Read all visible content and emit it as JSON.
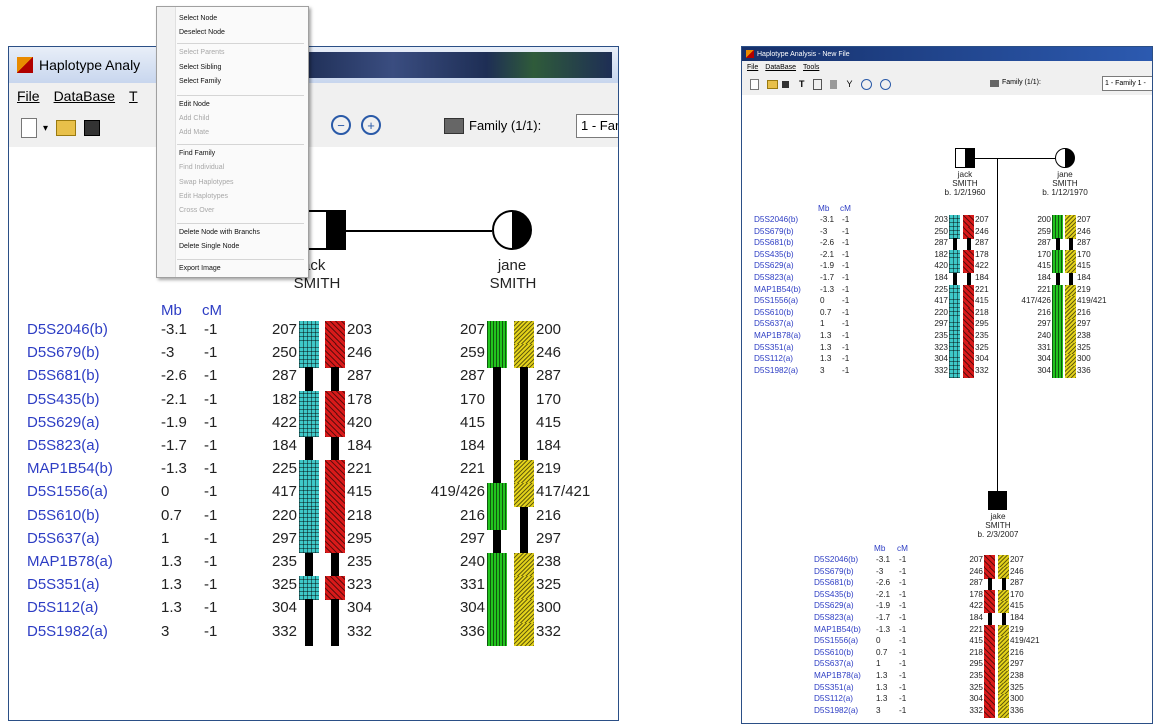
{
  "left_window": {
    "title": "Haplotype Analy",
    "menu": [
      "File",
      "DataBase",
      "T"
    ],
    "toolbar": {
      "family_label": "Family (1/1):",
      "family_select": "1 - Far"
    },
    "father": {
      "first": "jack",
      "last": "SMITH"
    },
    "mother": {
      "first": "jane",
      "last": "SMITH"
    },
    "col_headers": {
      "mb": "Mb",
      "cm": "cM"
    },
    "markers": [
      {
        "name": "D5S2046(b)",
        "mb": "-3.1",
        "cm": "-1",
        "f1": "207",
        "f2": "203",
        "m1": "207",
        "m2": "200"
      },
      {
        "name": "D5S679(b)",
        "mb": "-3",
        "cm": "-1",
        "f1": "250",
        "f2": "246",
        "m1": "259",
        "m2": "246"
      },
      {
        "name": "D5S681(b)",
        "mb": "-2.6",
        "cm": "-1",
        "f1": "287",
        "f2": "287",
        "m1": "287",
        "m2": "287"
      },
      {
        "name": "D5S435(b)",
        "mb": "-2.1",
        "cm": "-1",
        "f1": "182",
        "f2": "178",
        "m1": "170",
        "m2": "170"
      },
      {
        "name": "D5S629(a)",
        "mb": "-1.9",
        "cm": "-1",
        "f1": "422",
        "f2": "420",
        "m1": "415",
        "m2": "415"
      },
      {
        "name": "D5S823(a)",
        "mb": "-1.7",
        "cm": "-1",
        "f1": "184",
        "f2": "184",
        "m1": "184",
        "m2": "184"
      },
      {
        "name": "MAP1B54(b)",
        "mb": "-1.3",
        "cm": "-1",
        "f1": "225",
        "f2": "221",
        "m1": "221",
        "m2": "219"
      },
      {
        "name": "D5S1556(a)",
        "mb": "0",
        "cm": "-1",
        "f1": "417",
        "f2": "415",
        "m1": "419/426",
        "m2": "417/421"
      },
      {
        "name": "D5S610(b)",
        "mb": "0.7",
        "cm": "-1",
        "f1": "220",
        "f2": "218",
        "m1": "216",
        "m2": "216"
      },
      {
        "name": "D5S637(a)",
        "mb": "1",
        "cm": "-1",
        "f1": "297",
        "f2": "295",
        "m1": "297",
        "m2": "297"
      },
      {
        "name": "MAP1B78(a)",
        "mb": "1.3",
        "cm": "-1",
        "f1": "235",
        "f2": "235",
        "m1": "240",
        "m2": "238"
      },
      {
        "name": "D5S351(a)",
        "mb": "1.3",
        "cm": "-1",
        "f1": "325",
        "f2": "323",
        "m1": "331",
        "m2": "325"
      },
      {
        "name": "D5S112(a)",
        "mb": "1.3",
        "cm": "-1",
        "f1": "304",
        "f2": "304",
        "m1": "304",
        "m2": "300"
      },
      {
        "name": "D5S1982(a)",
        "mb": "3",
        "cm": "-1",
        "f1": "332",
        "f2": "332",
        "m1": "336",
        "m2": "332"
      }
    ],
    "context_menu": [
      {
        "label": "Select Node",
        "enabled": true
      },
      {
        "label": "Deselect Node",
        "enabled": true
      },
      {
        "label": "Select Parents",
        "enabled": false
      },
      {
        "label": "Select Sibling",
        "enabled": true
      },
      {
        "label": "Select Family",
        "enabled": true
      },
      {
        "label": "Edit Node",
        "enabled": true
      },
      {
        "label": "Add Child",
        "enabled": false
      },
      {
        "label": "Add Mate",
        "enabled": false
      },
      {
        "label": "Find Family",
        "enabled": true
      },
      {
        "label": "Find Individual",
        "enabled": false
      },
      {
        "label": "Swap Haplotypes",
        "enabled": false
      },
      {
        "label": "Edit Haplotypes",
        "enabled": false
      },
      {
        "label": "Cross Over",
        "enabled": false
      },
      {
        "label": "Delete Node with Branchs",
        "enabled": true
      },
      {
        "label": "Delete Single Node",
        "enabled": true
      },
      {
        "label": "Export Image",
        "enabled": true
      }
    ]
  },
  "right_window": {
    "title": "Haplotype Analysis - New File",
    "menu": [
      "File",
      "DataBase",
      "Tools"
    ],
    "toolbar": {
      "family_label": "Family (1/1):",
      "family_select": "1 - Family 1 -"
    },
    "father": {
      "first": "jack",
      "last": "SMITH",
      "birth": "b. 1/2/1960"
    },
    "mother": {
      "first": "jane",
      "last": "SMITH",
      "birth": "b. 1/12/1970"
    },
    "child": {
      "first": "jake",
      "last": "SMITH",
      "birth": "b. 2/3/2007"
    },
    "col_headers": {
      "mb": "Mb",
      "cm": "cM"
    },
    "markers": [
      {
        "name": "D5S2046(b)",
        "mb": "-3.1",
        "cm": "-1",
        "f1": "203",
        "f2": "207",
        "m1": "200",
        "m2": "207",
        "c1": "207",
        "c2": "207"
      },
      {
        "name": "D5S679(b)",
        "mb": "-3",
        "cm": "-1",
        "f1": "250",
        "f2": "246",
        "m1": "259",
        "m2": "246",
        "c1": "246",
        "c2": "246"
      },
      {
        "name": "D5S681(b)",
        "mb": "-2.6",
        "cm": "-1",
        "f1": "287",
        "f2": "287",
        "m1": "287",
        "m2": "287",
        "c1": "287",
        "c2": "287"
      },
      {
        "name": "D5S435(b)",
        "mb": "-2.1",
        "cm": "-1",
        "f1": "182",
        "f2": "178",
        "m1": "170",
        "m2": "170",
        "c1": "178",
        "c2": "170"
      },
      {
        "name": "D5S629(a)",
        "mb": "-1.9",
        "cm": "-1",
        "f1": "420",
        "f2": "422",
        "m1": "415",
        "m2": "415",
        "c1": "422",
        "c2": "415"
      },
      {
        "name": "D5S823(a)",
        "mb": "-1.7",
        "cm": "-1",
        "f1": "184",
        "f2": "184",
        "m1": "184",
        "m2": "184",
        "c1": "184",
        "c2": "184"
      },
      {
        "name": "MAP1B54(b)",
        "mb": "-1.3",
        "cm": "-1",
        "f1": "225",
        "f2": "221",
        "m1": "221",
        "m2": "219",
        "c1": "221",
        "c2": "219"
      },
      {
        "name": "D5S1556(a)",
        "mb": "0",
        "cm": "-1",
        "f1": "417",
        "f2": "415",
        "m1": "417/426",
        "m2": "419/421",
        "c1": "415",
        "c2": "419/421"
      },
      {
        "name": "D5S610(b)",
        "mb": "0.7",
        "cm": "-1",
        "f1": "220",
        "f2": "218",
        "m1": "216",
        "m2": "216",
        "c1": "218",
        "c2": "216"
      },
      {
        "name": "D5S637(a)",
        "mb": "1",
        "cm": "-1",
        "f1": "297",
        "f2": "295",
        "m1": "297",
        "m2": "297",
        "c1": "295",
        "c2": "297"
      },
      {
        "name": "MAP1B78(a)",
        "mb": "1.3",
        "cm": "-1",
        "f1": "235",
        "f2": "235",
        "m1": "240",
        "m2": "238",
        "c1": "235",
        "c2": "238"
      },
      {
        "name": "D5S351(a)",
        "mb": "1.3",
        "cm": "-1",
        "f1": "323",
        "f2": "325",
        "m1": "331",
        "m2": "325",
        "c1": "325",
        "c2": "325"
      },
      {
        "name": "D5S112(a)",
        "mb": "1.3",
        "cm": "-1",
        "f1": "304",
        "f2": "304",
        "m1": "304",
        "m2": "300",
        "c1": "304",
        "c2": "300"
      },
      {
        "name": "D5S1982(a)",
        "mb": "3",
        "cm": "-1",
        "f1": "332",
        "f2": "332",
        "m1": "304",
        "m2": "336",
        "c1": "332",
        "c2": "336"
      }
    ]
  },
  "colors": {
    "cyan": "#3ec8c8",
    "red": "#d81a1a",
    "green": "#22c41e",
    "yellow": "#e3d21a",
    "black": "#000000",
    "marker_text": "#2d3dc4"
  },
  "haplotype_patterns": {
    "left": {
      "father_left": [
        "cyan",
        "cyan",
        "black",
        "cyan",
        "cyan",
        "black",
        "cyan",
        "cyan",
        "cyan",
        "cyan",
        "black",
        "cyan",
        "black",
        "black"
      ],
      "father_right": [
        "red",
        "red",
        "black",
        "red",
        "red",
        "black",
        "red",
        "red",
        "red",
        "red",
        "black",
        "red",
        "black",
        "black"
      ],
      "mother_left": [
        "green",
        "green",
        "black",
        "black",
        "black",
        "black",
        "black",
        "green",
        "green",
        "black",
        "green",
        "green",
        "green",
        "green"
      ],
      "mother_right": [
        "yellow",
        "yellow",
        "black",
        "black",
        "black",
        "black",
        "yellow",
        "yellow",
        "black",
        "black",
        "yellow",
        "yellow",
        "yellow",
        "yellow"
      ]
    },
    "right": {
      "father_left": [
        "cyan",
        "cyan",
        "black",
        "cyan",
        "cyan",
        "black",
        "cyan",
        "cyan",
        "cyan",
        "cyan",
        "cyan",
        "cyan",
        "cyan",
        "cyan"
      ],
      "father_right": [
        "red",
        "red",
        "black",
        "red",
        "red",
        "black",
        "red",
        "red",
        "red",
        "red",
        "red",
        "red",
        "red",
        "red"
      ],
      "mother_left": [
        "green",
        "green",
        "black",
        "green",
        "green",
        "black",
        "green",
        "green",
        "green",
        "green",
        "green",
        "green",
        "green",
        "green"
      ],
      "mother_right": [
        "yellow",
        "yellow",
        "black",
        "yellow",
        "yellow",
        "black",
        "yellow",
        "yellow",
        "yellow",
        "yellow",
        "yellow",
        "yellow",
        "yellow",
        "yellow"
      ],
      "child_left": [
        "red",
        "red",
        "black",
        "red",
        "red",
        "black",
        "red",
        "red",
        "red",
        "red",
        "red",
        "red",
        "red",
        "red"
      ],
      "child_right": [
        "yellow",
        "yellow",
        "black",
        "yellow",
        "yellow",
        "black",
        "yellow",
        "yellow",
        "yellow",
        "yellow",
        "yellow",
        "yellow",
        "yellow",
        "yellow"
      ]
    }
  }
}
